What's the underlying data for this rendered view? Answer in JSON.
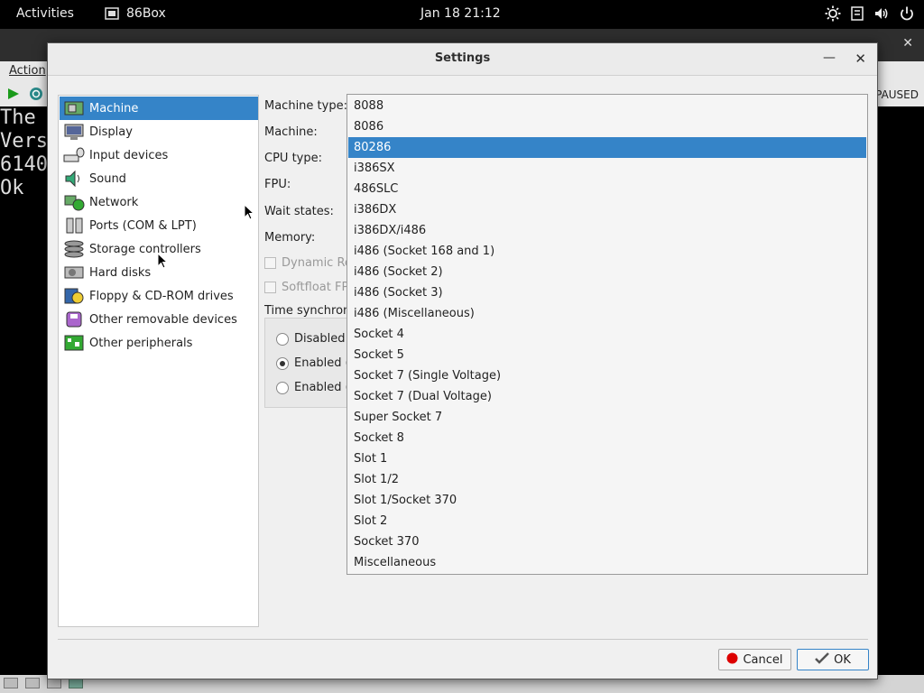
{
  "topbar": {
    "activities": "Activities",
    "app_name": "86Box",
    "clock": "Jan 18  21:12",
    "tray_icons": [
      "brightness-icon",
      "accessibility-icon",
      "volume-icon",
      "power-icon"
    ]
  },
  "background_window": {
    "menu_action": "Action",
    "paused_label": "PAUSED",
    "screen_text": [
      "The",
      "Vers",
      "6140",
      "Ok"
    ]
  },
  "dialog": {
    "title": "Settings",
    "categories": [
      {
        "label": "Machine",
        "icon": "machine-icon",
        "selected": true
      },
      {
        "label": "Display",
        "icon": "display-icon"
      },
      {
        "label": "Input devices",
        "icon": "input-devices-icon"
      },
      {
        "label": "Sound",
        "icon": "sound-icon"
      },
      {
        "label": "Network",
        "icon": "network-icon"
      },
      {
        "label": "Ports (COM & LPT)",
        "icon": "ports-icon"
      },
      {
        "label": "Storage controllers",
        "icon": "storage-controllers-icon"
      },
      {
        "label": "Hard disks",
        "icon": "hard-disk-icon"
      },
      {
        "label": "Floppy & CD-ROM drives",
        "icon": "floppy-cdrom-icon"
      },
      {
        "label": "Other removable devices",
        "icon": "removable-devices-icon"
      },
      {
        "label": "Other peripherals",
        "icon": "peripherals-icon"
      }
    ],
    "form": {
      "machine_type_label": "Machine type:",
      "machine_label": "Machine:",
      "cpu_type_label": "CPU type:",
      "fpu_label": "FPU:",
      "wait_states_label": "Wait states:",
      "memory_label": "Memory:",
      "dynamic_recompiler": "Dynamic Re",
      "softfloat_fpu": "Softfloat FPU",
      "time_sync_label": "Time synchroni",
      "time_sync_options": [
        {
          "label": "Disabled",
          "checked": false
        },
        {
          "label": "Enabled (l",
          "checked": true
        },
        {
          "label": "Enabled (U",
          "checked": false
        }
      ]
    },
    "machine_type_dropdown": {
      "selected": "80286",
      "options": [
        "8088",
        "8086",
        "80286",
        "i386SX",
        "486SLC",
        "i386DX",
        "i386DX/i486",
        "i486 (Socket 168 and 1)",
        "i486 (Socket 2)",
        "i486 (Socket 3)",
        "i486 (Miscellaneous)",
        "Socket 4",
        "Socket 5",
        "Socket 7 (Single Voltage)",
        "Socket 7 (Dual Voltage)",
        "Super Socket 7",
        "Socket 8",
        "Slot 1",
        "Slot 1/2",
        "Slot 1/Socket 370",
        "Slot 2",
        "Socket 370",
        "Miscellaneous"
      ]
    },
    "buttons": {
      "cancel": "Cancel",
      "ok": "OK"
    }
  },
  "colors": {
    "selection": "#3584c8",
    "dialog_bg": "#f0f0f0",
    "topbar_bg": "#000000"
  }
}
